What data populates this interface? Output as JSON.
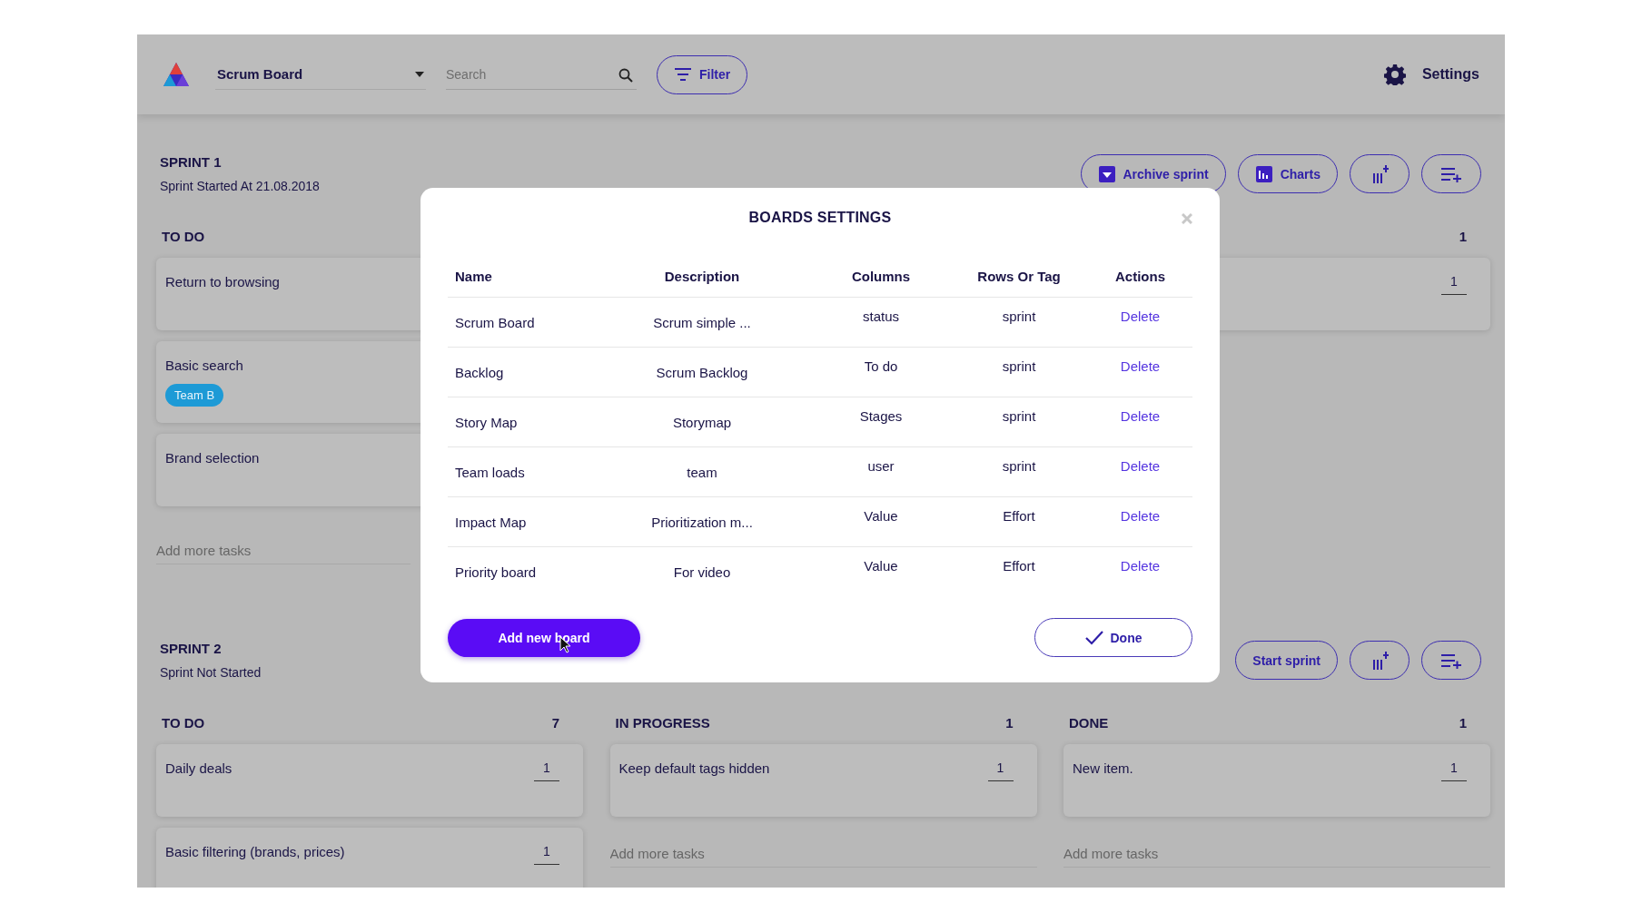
{
  "app_bar": {
    "board": "Scrum Board",
    "search": {
      "placeholder": "Search"
    },
    "filter": "Filter",
    "settings": "Settings"
  },
  "sprints": [
    {
      "title": "SPRINT 1",
      "status": "Sprint Started At 21.08.2018",
      "actions": [
        {
          "kind": "archive",
          "label": "Archive sprint"
        },
        {
          "kind": "charts",
          "label": "Charts"
        },
        {
          "kind": "add-column"
        },
        {
          "kind": "add-row"
        }
      ],
      "columns": [
        {
          "title": "TO DO",
          "cards": [
            {
              "title": "Return to browsing"
            },
            {
              "title": "Basic search",
              "tags": [
                {
                  "label": "Team B",
                  "color": "#1d9ad6"
                }
              ]
            },
            {
              "title": "Brand selection"
            }
          ],
          "add_placeholder": "Add more tasks"
        },
        {
          "count": "1",
          "cards": [
            {
              "estimate": "1"
            }
          ]
        }
      ]
    },
    {
      "title": "SPRINT 2",
      "status": "Sprint Not Started",
      "actions": [
        {
          "kind": "start",
          "label": "Start sprint"
        },
        {
          "kind": "add-column"
        },
        {
          "kind": "add-row"
        }
      ],
      "columns": [
        {
          "title": "TO DO",
          "count": "7",
          "cards": [
            {
              "title": "Daily deals",
              "estimate": "1"
            },
            {
              "title": "Basic filtering (brands, prices)",
              "estimate": "1"
            }
          ]
        },
        {
          "title": "IN PROGRESS",
          "count": "1",
          "cards": [
            {
              "title": "Keep default tags hidden",
              "estimate": "1"
            }
          ],
          "add_placeholder": "Add more tasks"
        },
        {
          "title": "DONE",
          "count": "1",
          "cards": [
            {
              "title": "New item.",
              "estimate": "1"
            }
          ],
          "add_placeholder": "Add more tasks"
        }
      ]
    }
  ],
  "dialog": {
    "title": "BOARDS SETTINGS",
    "columns": [
      "Name",
      "Description",
      "Columns",
      "Rows Or Tag",
      "Actions"
    ],
    "rows": [
      {
        "name": "Scrum Board",
        "description": "Scrum simple ...",
        "columns": "status",
        "rows_or_tag": "sprint",
        "action": "Delete"
      },
      {
        "name": "Backlog",
        "description": "Scrum Backlog",
        "columns": "To do",
        "rows_or_tag": "sprint",
        "action": "Delete"
      },
      {
        "name": "Story Map",
        "description": "Storymap",
        "columns": "Stages",
        "rows_or_tag": "sprint",
        "action": "Delete"
      },
      {
        "name": "Team loads",
        "description": "team",
        "columns": "user",
        "rows_or_tag": "sprint",
        "action": "Delete"
      },
      {
        "name": "Impact Map",
        "description": "Prioritization m...",
        "columns": "Value",
        "rows_or_tag": "Effort",
        "action": "Delete"
      },
      {
        "name": "Priority board",
        "description": "For video",
        "columns": "Value",
        "rows_or_tag": "Effort",
        "action": "Delete"
      }
    ],
    "add_button": "Add new board",
    "done_button": "Done"
  }
}
